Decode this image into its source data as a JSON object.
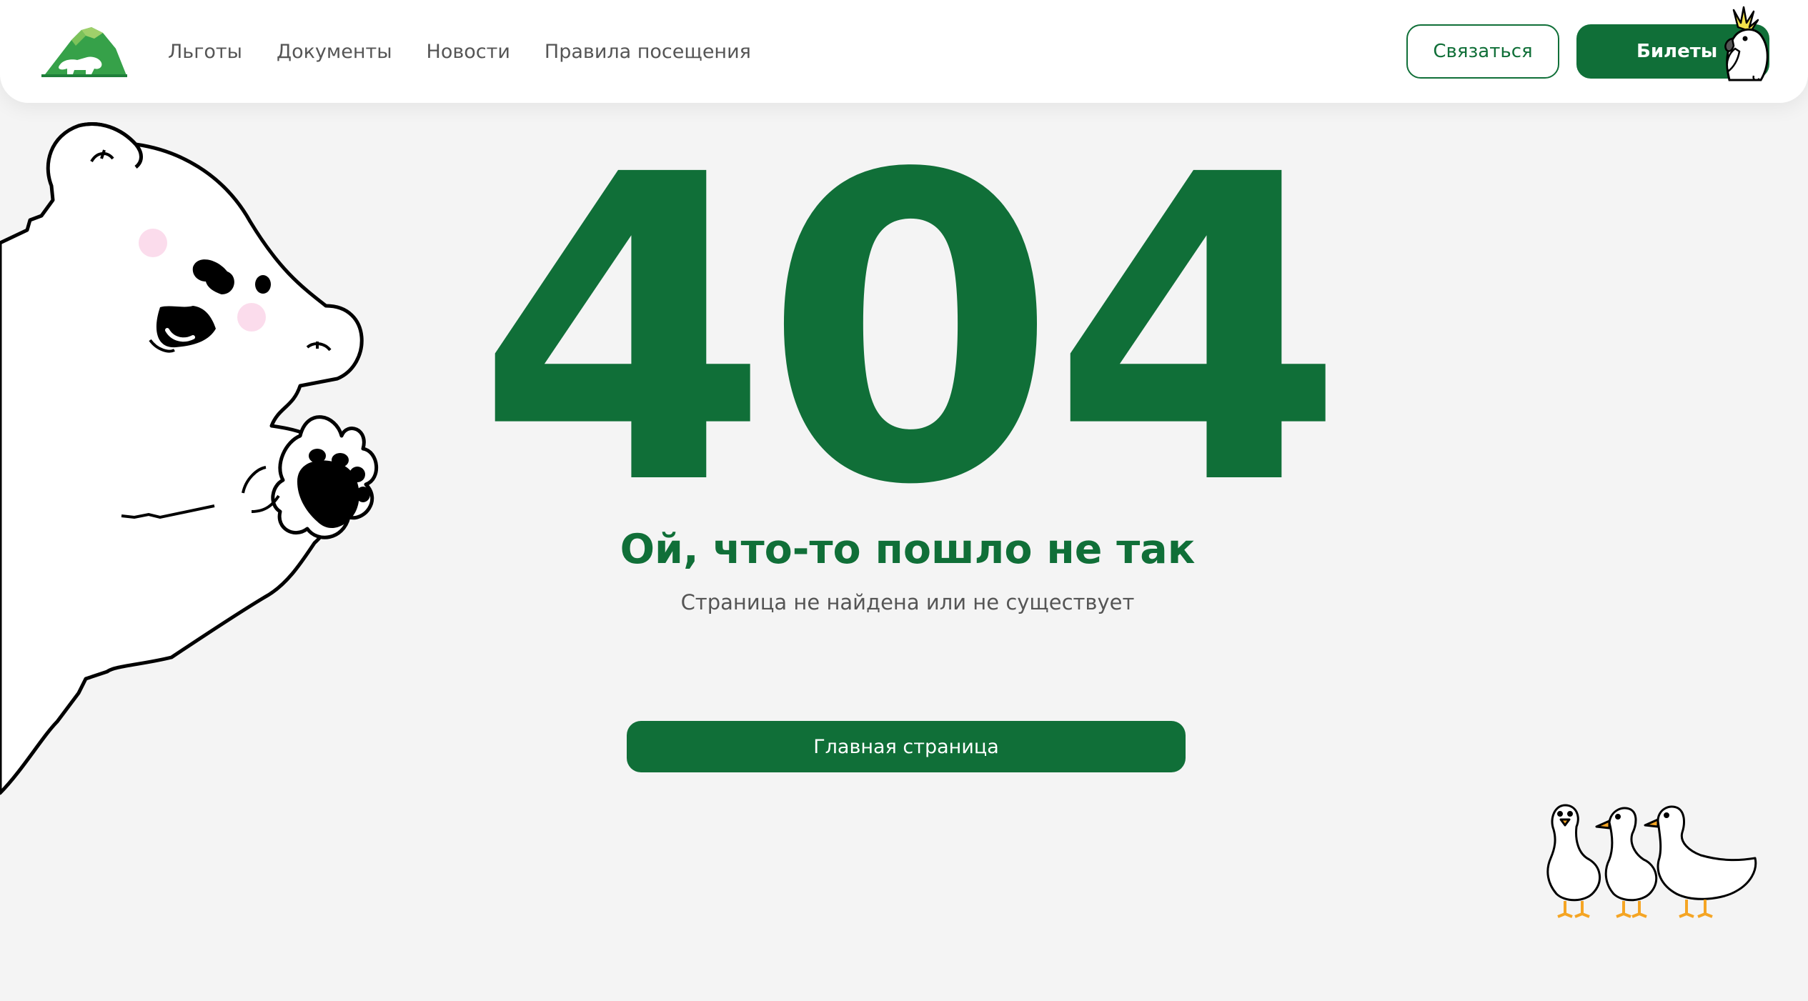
{
  "header": {
    "logo_icon": "mountain-bear-logo-icon",
    "nav": [
      {
        "label": "Льготы"
      },
      {
        "label": "Документы"
      },
      {
        "label": "Новости"
      },
      {
        "label": "Правила посещения"
      }
    ],
    "contact_button": "Связаться",
    "tickets_button": "Билеты",
    "tickets_icon": "parrot-icon"
  },
  "main": {
    "error_code": "404",
    "title": "Ой, что-то пошло не так",
    "subtitle": "Страница не найдена или не существует",
    "home_button": "Главная страница"
  },
  "illustrations": {
    "left": "polar-bear-illustration",
    "bottom_right": "geese-illustration"
  },
  "colors": {
    "accent": "#106f38",
    "background": "#f4f4f4",
    "header_background": "#ffffff",
    "nav_text": "#555555"
  }
}
